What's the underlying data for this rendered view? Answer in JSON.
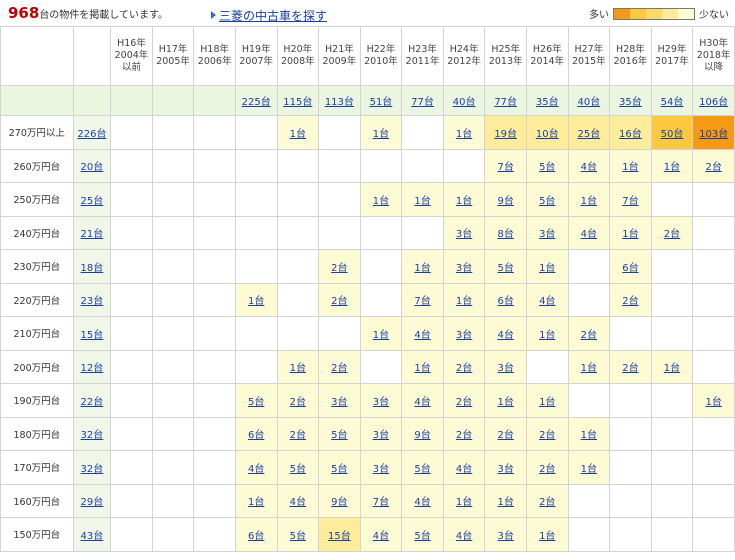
{
  "header": {
    "count_number": "968",
    "count_text": "台の物件を掲載しています。",
    "search_link": "三菱の中古車を探す",
    "legend_many": "多い",
    "legend_few": "少ない",
    "legend_colors": [
      "#f59a12",
      "#fbc840",
      "#fdd96a",
      "#fdec9a",
      "#fdfbd3"
    ]
  },
  "columns": [
    "H16年\n2004年\n以前",
    "H17年\n2005年",
    "H18年\n2006年",
    "H19年\n2007年",
    "H20年\n2008年",
    "H21年\n2009年",
    "H22年\n2010年",
    "H23年\n2011年",
    "H24年\n2012年",
    "H25年\n2013年",
    "H26年\n2014年",
    "H27年\n2015年",
    "H28年\n2016年",
    "H29年\n2017年",
    "H30年\n2018年\n以降"
  ],
  "column_totals": [
    "",
    "",
    "",
    "225台",
    "115台",
    "113台",
    "51台",
    "77台",
    "40台",
    "77台",
    "35台",
    "40台",
    "35台",
    "54台",
    "106台"
  ],
  "rows": [
    {
      "label": "270万円以上",
      "total": "226台",
      "cells": [
        "",
        "",
        "",
        "",
        "1台",
        "",
        "1台",
        "",
        "1台",
        "19台",
        "10台",
        "25台",
        "16台",
        "50台",
        "103台"
      ],
      "levels": [
        0,
        0,
        0,
        0,
        1,
        0,
        1,
        0,
        1,
        2,
        2,
        2,
        2,
        3,
        4
      ]
    },
    {
      "label": "260万円台",
      "total": "20台",
      "cells": [
        "",
        "",
        "",
        "",
        "",
        "",
        "",
        "",
        "",
        "7台",
        "5台",
        "4台",
        "1台",
        "1台",
        "2台"
      ],
      "levels": [
        0,
        0,
        0,
        0,
        0,
        0,
        0,
        0,
        0,
        1,
        1,
        1,
        1,
        1,
        1
      ]
    },
    {
      "label": "250万円台",
      "total": "25台",
      "cells": [
        "",
        "",
        "",
        "",
        "",
        "",
        "1台",
        "1台",
        "1台",
        "9台",
        "5台",
        "1台",
        "7台",
        "",
        ""
      ],
      "levels": [
        0,
        0,
        0,
        0,
        0,
        0,
        1,
        1,
        1,
        1,
        1,
        1,
        1,
        0,
        0
      ]
    },
    {
      "label": "240万円台",
      "total": "21台",
      "cells": [
        "",
        "",
        "",
        "",
        "",
        "",
        "",
        "",
        "3台",
        "8台",
        "3台",
        "4台",
        "1台",
        "2台",
        ""
      ],
      "levels": [
        0,
        0,
        0,
        0,
        0,
        0,
        0,
        0,
        1,
        1,
        1,
        1,
        1,
        1,
        0
      ]
    },
    {
      "label": "230万円台",
      "total": "18台",
      "cells": [
        "",
        "",
        "",
        "",
        "",
        "2台",
        "",
        "1台",
        "3台",
        "5台",
        "1台",
        "",
        "6台",
        "",
        ""
      ],
      "levels": [
        0,
        0,
        0,
        0,
        0,
        1,
        0,
        1,
        1,
        1,
        1,
        0,
        1,
        0,
        0
      ]
    },
    {
      "label": "220万円台",
      "total": "23台",
      "cells": [
        "",
        "",
        "",
        "1台",
        "",
        "2台",
        "",
        "7台",
        "1台",
        "6台",
        "4台",
        "",
        "2台",
        "",
        ""
      ],
      "levels": [
        0,
        0,
        0,
        1,
        0,
        1,
        0,
        1,
        1,
        1,
        1,
        0,
        1,
        0,
        0
      ]
    },
    {
      "label": "210万円台",
      "total": "15台",
      "cells": [
        "",
        "",
        "",
        "",
        "",
        "",
        "1台",
        "4台",
        "3台",
        "4台",
        "1台",
        "2台",
        "",
        "",
        ""
      ],
      "levels": [
        0,
        0,
        0,
        0,
        0,
        0,
        1,
        1,
        1,
        1,
        1,
        1,
        0,
        0,
        0
      ]
    },
    {
      "label": "200万円台",
      "total": "12台",
      "cells": [
        "",
        "",
        "",
        "",
        "1台",
        "2台",
        "",
        "1台",
        "2台",
        "3台",
        "",
        "1台",
        "2台",
        "1台",
        ""
      ],
      "levels": [
        0,
        0,
        0,
        0,
        1,
        1,
        0,
        1,
        1,
        1,
        0,
        1,
        1,
        1,
        0
      ]
    },
    {
      "label": "190万円台",
      "total": "22台",
      "cells": [
        "",
        "",
        "",
        "5台",
        "2台",
        "3台",
        "3台",
        "4台",
        "2台",
        "1台",
        "1台",
        "",
        "",
        "",
        "1台"
      ],
      "levels": [
        0,
        0,
        0,
        1,
        1,
        1,
        1,
        1,
        1,
        1,
        1,
        0,
        0,
        0,
        1
      ]
    },
    {
      "label": "180万円台",
      "total": "32台",
      "cells": [
        "",
        "",
        "",
        "6台",
        "2台",
        "5台",
        "3台",
        "9台",
        "2台",
        "2台",
        "2台",
        "1台",
        "",
        "",
        ""
      ],
      "levels": [
        0,
        0,
        0,
        1,
        1,
        1,
        1,
        1,
        1,
        1,
        1,
        1,
        0,
        0,
        0
      ]
    },
    {
      "label": "170万円台",
      "total": "32台",
      "cells": [
        "",
        "",
        "",
        "4台",
        "5台",
        "5台",
        "3台",
        "5台",
        "4台",
        "3台",
        "2台",
        "1台",
        "",
        "",
        ""
      ],
      "levels": [
        0,
        0,
        0,
        1,
        1,
        1,
        1,
        1,
        1,
        1,
        1,
        1,
        0,
        0,
        0
      ]
    },
    {
      "label": "160万円台",
      "total": "29台",
      "cells": [
        "",
        "",
        "",
        "1台",
        "4台",
        "9台",
        "7台",
        "4台",
        "1台",
        "1台",
        "2台",
        "",
        "",
        "",
        ""
      ],
      "levels": [
        0,
        0,
        0,
        1,
        1,
        1,
        1,
        1,
        1,
        1,
        1,
        0,
        0,
        0,
        0
      ]
    },
    {
      "label": "150万円台",
      "total": "43台",
      "cells": [
        "",
        "",
        "",
        "6台",
        "5台",
        "15台",
        "4台",
        "5台",
        "4台",
        "3台",
        "1台",
        "",
        "",
        "",
        ""
      ],
      "levels": [
        0,
        0,
        0,
        1,
        1,
        2,
        1,
        1,
        1,
        1,
        1,
        0,
        0,
        0,
        0
      ]
    }
  ]
}
